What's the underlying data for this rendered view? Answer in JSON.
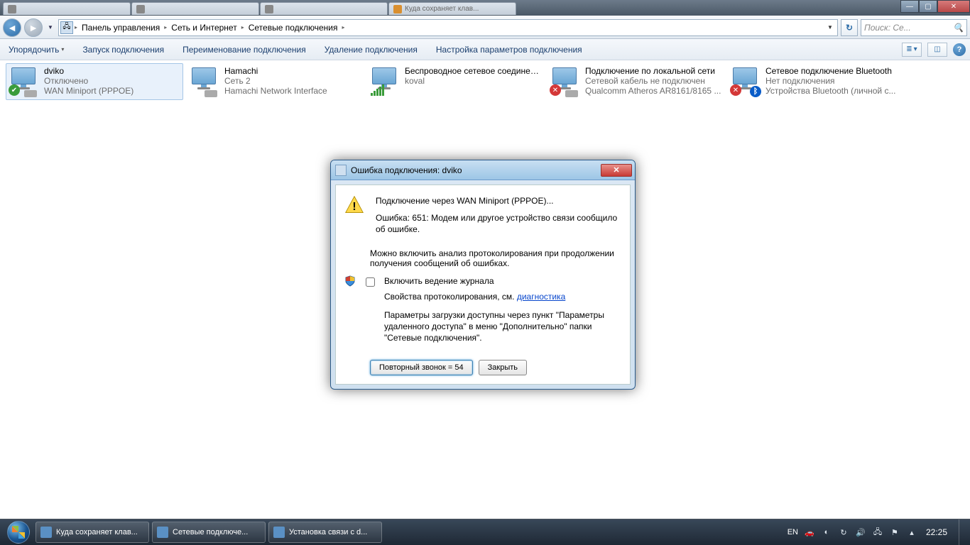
{
  "browserTabs": [
    "",
    "",
    "",
    "Куда сохраняет клав..."
  ],
  "windowControls": {
    "min": "—",
    "max": "▢",
    "close": "✕"
  },
  "breadcrumbs": [
    "Панель управления",
    "Сеть и Интернет",
    "Сетевые подключения"
  ],
  "addressDropdown": "▼",
  "refresh": "↻",
  "search": {
    "placeholder": "Поиск: Се...",
    "icon": "🔍"
  },
  "toolbar": {
    "organize": "Упорядочить",
    "start": "Запуск подключения",
    "rename": "Переименование подключения",
    "delete": "Удаление подключения",
    "settings": "Настройка параметров подключения",
    "dd": "▾"
  },
  "connections": [
    {
      "name": "dviko",
      "status": "Отключено",
      "device": "WAN Miniport (PPPOE)",
      "badge": "ok",
      "selected": true
    },
    {
      "name": "Hamachi",
      "status": "Сеть 2",
      "device": "Hamachi Network Interface",
      "badge": "none"
    },
    {
      "name": "Беспроводное сетевое соединение",
      "status": "",
      "device": "koval",
      "badge": "signal"
    },
    {
      "name": "Подключение по локальной сети",
      "status": "Сетевой кабель не подключен",
      "device": "Qualcomm Atheros AR8161/8165 ...",
      "badge": "x"
    },
    {
      "name": "Сетевое подключение Bluetooth",
      "status": "Нет подключения",
      "device": "Устройства Bluetooth (личной с...",
      "badge": "bt-x"
    }
  ],
  "dialog": {
    "title": "Ошибка подключения: dviko",
    "line1": "Подключение через WAN Miniport (PPPOE)...",
    "line2": "Ошибка: 651: Модем или другое устройство связи сообщило об ошибке.",
    "line3": "Можно включить анализ протоколирования при продолжении получения сообщений об ошибках.",
    "chkLabel": "Включить ведение журнала",
    "logLine": "Свойства протоколирования, см. ",
    "logLink": "диагностика",
    "paramLine": "Параметры загрузки доступны через пункт \"Параметры удаленного доступа\" в меню \"Дополнительно\" папки \"Сетевые подключения\".",
    "btnRedial": "Повторный звонок = 54",
    "btnClose": "Закрыть",
    "x": "✕"
  },
  "taskbar": {
    "apps": [
      "Куда сохраняет клав...",
      "Сетевые подключе...",
      "Установка связи с d..."
    ],
    "lang": "EN",
    "clock": "22:25"
  }
}
